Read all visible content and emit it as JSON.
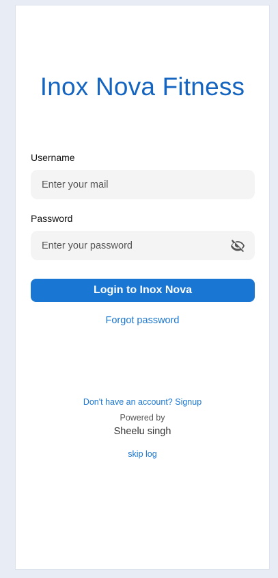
{
  "app": {
    "title": "Inox Nova Fitness"
  },
  "form": {
    "username_label": "Username",
    "username_placeholder": "Enter your mail",
    "password_label": "Password",
    "password_placeholder": "Enter your password",
    "toggle_icon": "eye-off-icon",
    "login_button": "Login to Inox Nova",
    "forgot_password": "Forgot password"
  },
  "footer": {
    "signup_link": "Don't have an account? Signup",
    "powered_by": "Powered by",
    "author": "Sheelu singh",
    "skip_link": "skip log"
  },
  "colors": {
    "brand": "#1565c0",
    "button": "#1976d2",
    "background": "#e8edf5"
  }
}
